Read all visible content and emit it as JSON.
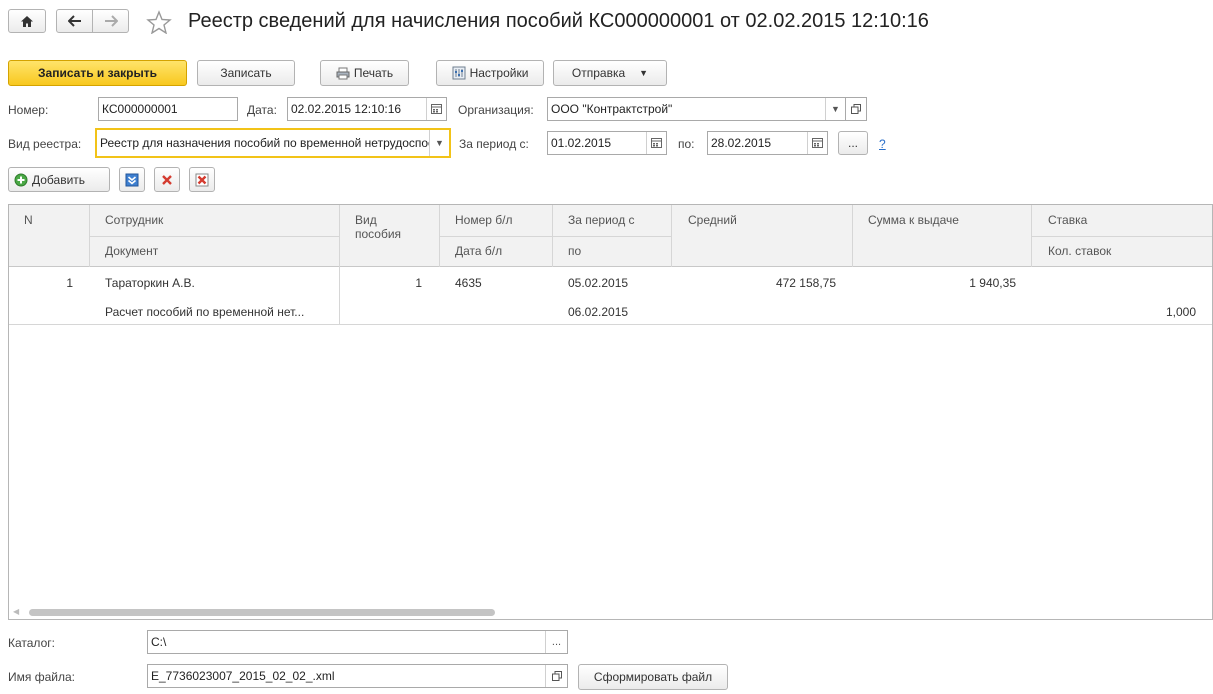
{
  "window": {
    "title": "Реестр сведений для начисления пособий КС000000001 от 02.02.2015 12:10:16"
  },
  "toolbar": {
    "save_close": "Записать и закрыть",
    "save": "Записать",
    "print": "Печать",
    "settings": "Настройки",
    "send": "Отправка"
  },
  "form": {
    "number_label": "Номер:",
    "number_value": "КС000000001",
    "date_label": "Дата:",
    "date_value": "02.02.2015 12:10:16",
    "org_label": "Организация:",
    "org_value": "ООО \"Контрактстрой\"",
    "registry_type_label": "Вид реестра:",
    "registry_type_value": "Реестр для назначения пособий по временной нетрудоспособности",
    "period_from_label": "За период с:",
    "period_from_value": "01.02.2015",
    "period_to_label": "по:",
    "period_to_value": "28.02.2015",
    "period_select": "...",
    "help": "?"
  },
  "table_toolbar": {
    "add": "Добавить"
  },
  "table": {
    "headers": {
      "n": "N",
      "employee": "Сотрудник",
      "document": "Документ",
      "benefit_type": "Вид\nпособия",
      "sick_number": "Номер б/л",
      "sick_date": "Дата б/л",
      "period_from": "За период с",
      "period_to": "по",
      "average": "Средний",
      "amount": "Сумма к выдаче",
      "rate": "Ставка",
      "rate_count": "Кол. ставок"
    },
    "rows": [
      {
        "n": "1",
        "employee": "Тараторкин А.В.",
        "document": "Расчет пособий по временной нет...",
        "benefit_type": "1",
        "sick_number": "4635",
        "sick_date": "",
        "period_from": "05.02.2015",
        "period_to": "06.02.2015",
        "average": "472 158,75",
        "amount": "1 940,35",
        "rate": "",
        "rate_count": "1,000"
      }
    ]
  },
  "footer": {
    "catalog_label": "Каталог:",
    "catalog_value": "C:\\",
    "catalog_select": "...",
    "filename_label": "Имя файла:",
    "filename_value": "E_7736023007_2015_02_02_.xml",
    "generate": "Сформировать файл"
  },
  "colors": {
    "primary_button": "#f8c81f",
    "focus_border": "#f2c318",
    "header_bg": "#f2f2f2",
    "link": "#2a6ec9"
  },
  "icons": [
    "home-icon",
    "back-arrow-icon",
    "forward-arrow-icon",
    "favorite-star-icon",
    "printer-icon",
    "settings-icon",
    "dropdown-icon",
    "calendar-icon",
    "open-icon",
    "add-icon",
    "move-down-icon",
    "delete-icon",
    "delete-all-icon"
  ]
}
